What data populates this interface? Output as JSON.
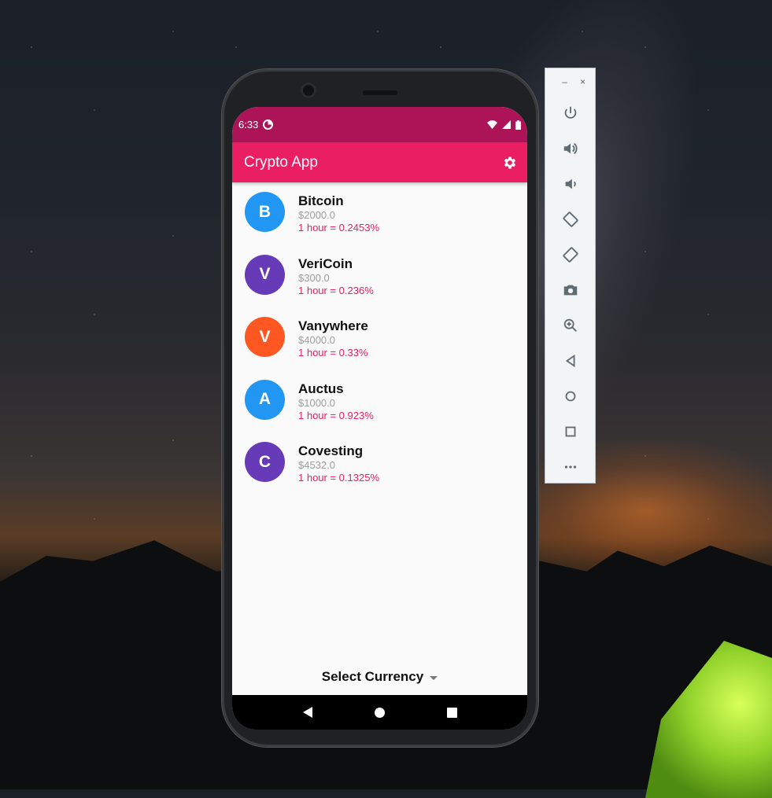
{
  "status_bar": {
    "time": "6:33"
  },
  "app_bar": {
    "title": "Crypto App"
  },
  "coins": [
    {
      "initial": "B",
      "name": "Bitcoin",
      "price": "$2000.0",
      "change": "1 hour = 0.2453%",
      "color": "#2196f3"
    },
    {
      "initial": "V",
      "name": "VeriCoin",
      "price": "$300.0",
      "change": "1 hour = 0.236%",
      "color": "#673ab7"
    },
    {
      "initial": "V",
      "name": "Vanywhere",
      "price": "$4000.0",
      "change": "1 hour = 0.33%",
      "color": "#ff5722"
    },
    {
      "initial": "A",
      "name": "Auctus",
      "price": "$1000.0",
      "change": "1 hour = 0.923%",
      "color": "#2196f3"
    },
    {
      "initial": "C",
      "name": "Covesting",
      "price": "$4532.0",
      "change": "1 hour = 0.1325%",
      "color": "#673ab7"
    }
  ],
  "currency_select": {
    "label": "Select Currency"
  },
  "theme": {
    "primary": "#e91e63",
    "primary_dark": "#ad1457",
    "price_color": "#9e9e9e"
  },
  "emulator_toolbar": {
    "window_controls": [
      "–",
      "×"
    ],
    "buttons": [
      "power-icon",
      "volume-up-icon",
      "volume-down-icon",
      "rotate-left-icon",
      "rotate-right-icon",
      "camera-icon",
      "zoom-icon",
      "back-icon",
      "home-icon",
      "overview-icon",
      "more-icon"
    ]
  }
}
